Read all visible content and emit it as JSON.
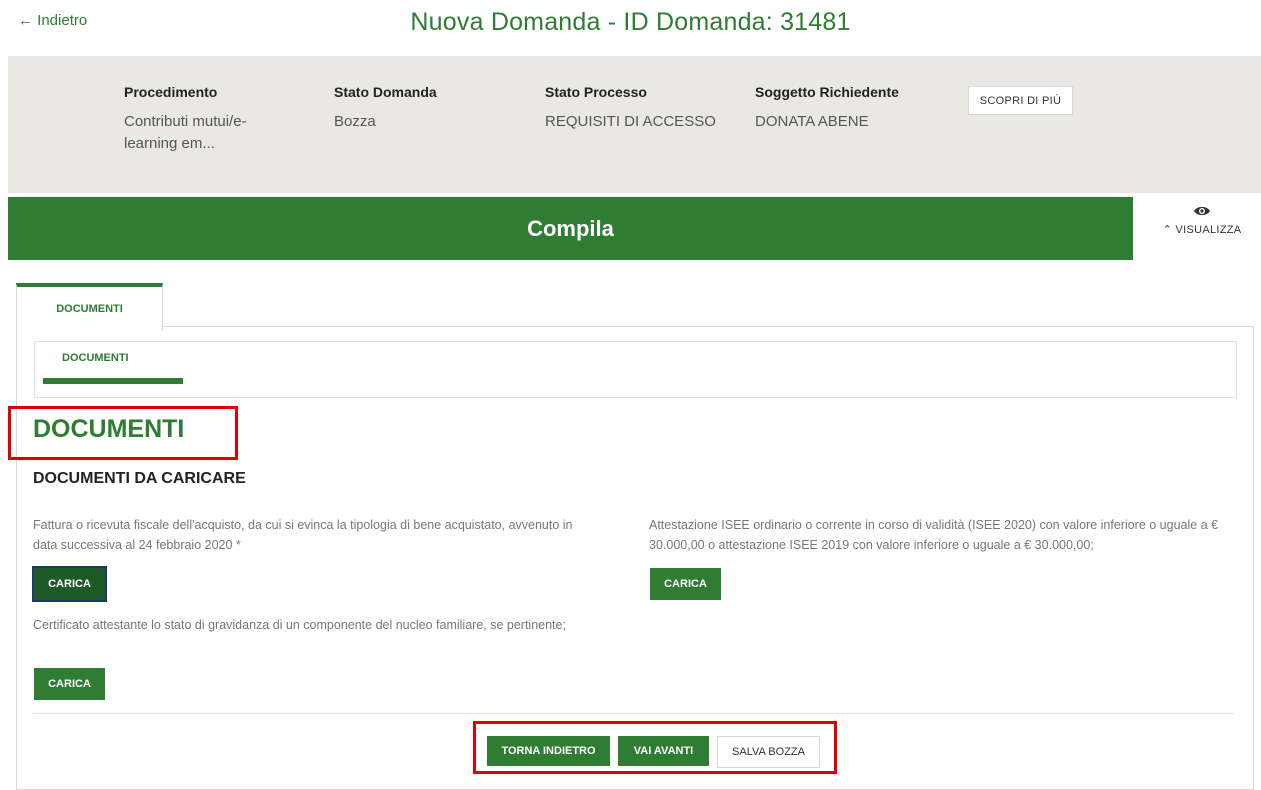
{
  "header": {
    "back_label": "← Indietro",
    "title": "Nuova Domanda - ID Domanda: 31481"
  },
  "info": {
    "items": [
      {
        "label": "Procedimento",
        "value": "Contributi mutui/e-learning em..."
      },
      {
        "label": "Stato Domanda",
        "value": "Bozza"
      },
      {
        "label": "Stato Processo",
        "value": "REQUISITI DI ACCESSO"
      },
      {
        "label": "Soggetto Richiedente",
        "value": "DONATA ABENE"
      }
    ],
    "discover_label": "SCOPRI DI PIÙ"
  },
  "step": {
    "label": "Compila",
    "visualizza_label": "VISUALIZZA"
  },
  "tabs": {
    "main": "DOCUMENTI",
    "sub": "DOCUMENTI"
  },
  "section": {
    "title": "DOCUMENTI",
    "subtitle": "DOCUMENTI DA CARICARE",
    "documents": [
      {
        "text": "Fattura o ricevuta fiscale dell'acquisto, da cui si evinca la tipologia di bene acquistato, avvenuto in data successiva al 24 febbraio 2020 *",
        "button": "CARICA"
      },
      {
        "text": "Attestazione ISEE ordinario o corrente in corso di validità (ISEE 2020) con valore inferiore o uguale a € 30.000,00 o attestazione ISEE 2019 con valore inferiore o uguale a € 30.000,00;",
        "button": "CARICA"
      },
      {
        "text": "Certificato attestante lo stato di gravidanza di un componente del nucleo familiare, se pertinente;",
        "button": "CARICA"
      }
    ]
  },
  "actions": {
    "back": "TORNA INDIETRO",
    "next": "VAI AVANTI",
    "save": "SALVA BOZZA"
  },
  "colors": {
    "brand_green": "#2e7d32",
    "highlight_red": "#e00000"
  }
}
